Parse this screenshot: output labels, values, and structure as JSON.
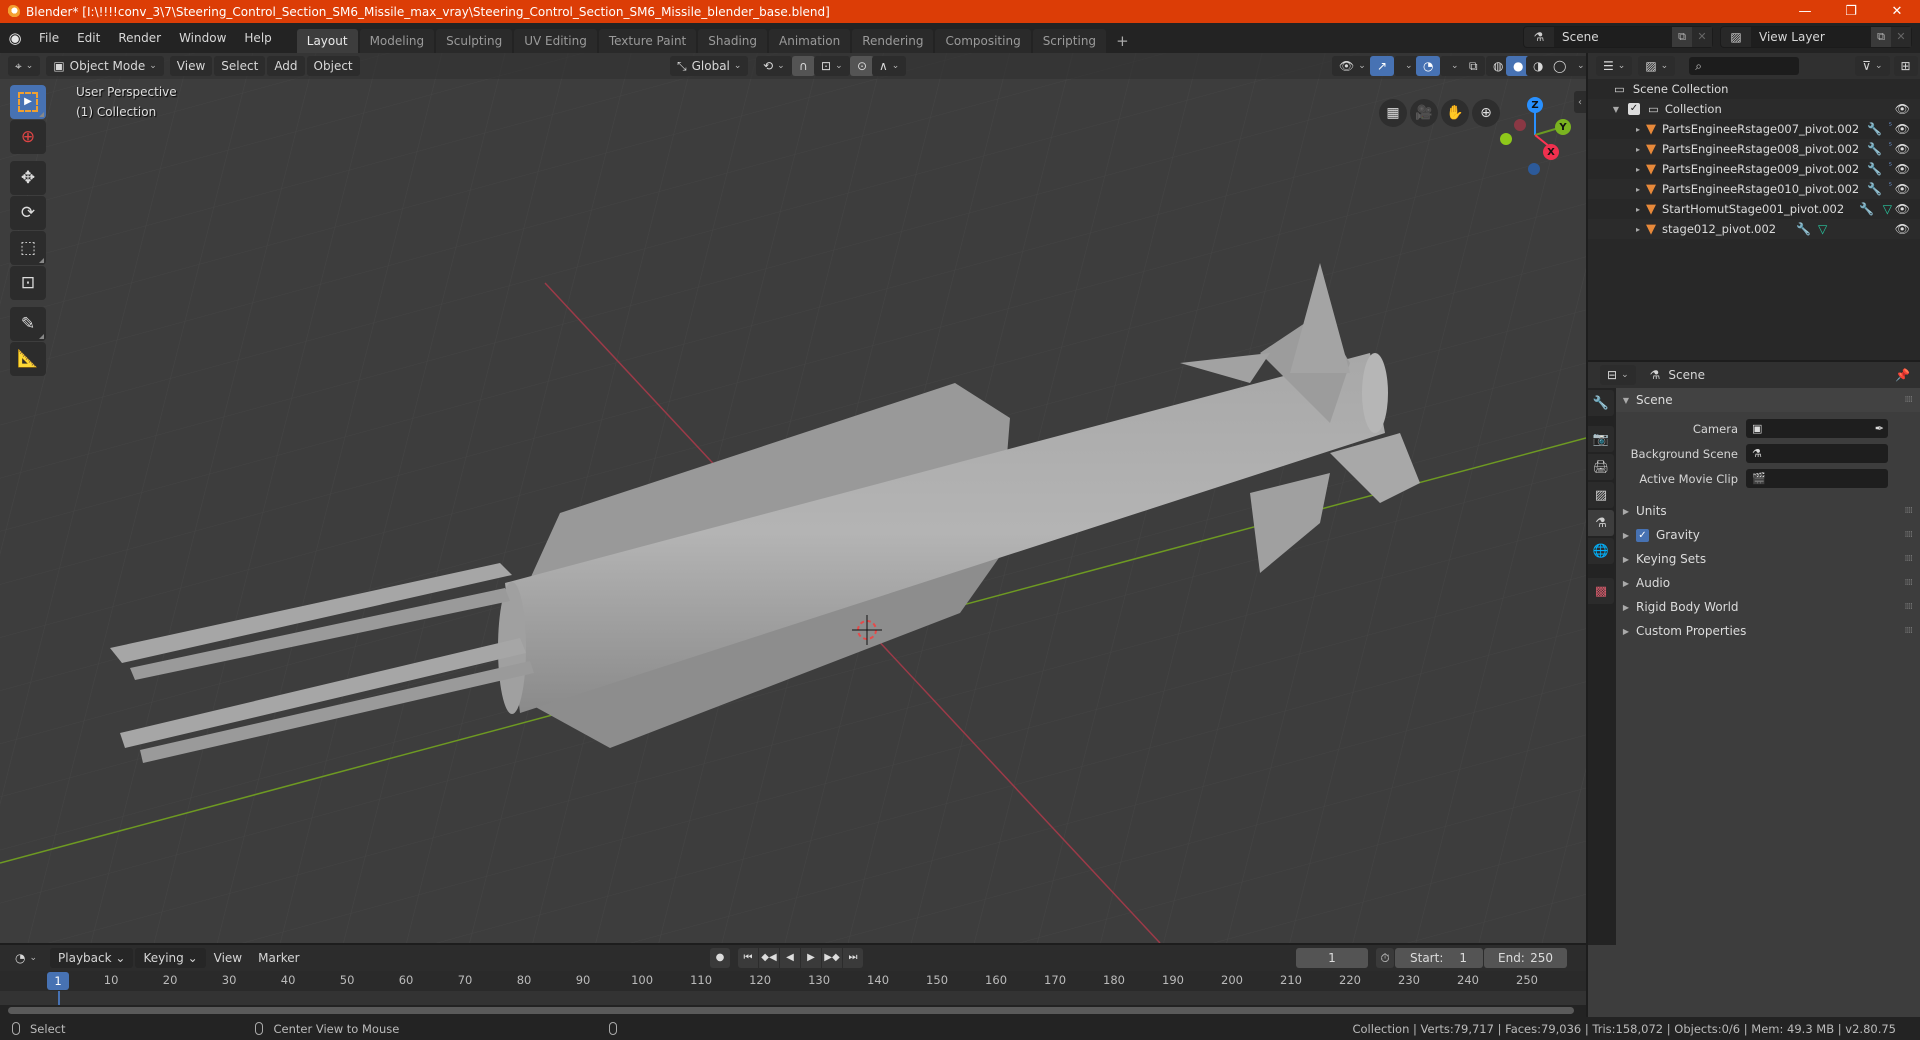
{
  "window": {
    "title": "Blender* [I:\\!!!!conv_3\\7\\Steering_Control_Section_SM6_Missile_max_vray\\Steering_Control_Section_SM6_Missile_blender_base.blend]",
    "controls": {
      "minimize": "—",
      "maximize": "❐",
      "close": "✕"
    }
  },
  "menubar": {
    "items": [
      "File",
      "Edit",
      "Render",
      "Window",
      "Help"
    ],
    "workspaces": [
      "Layout",
      "Modeling",
      "Sculpting",
      "UV Editing",
      "Texture Paint",
      "Shading",
      "Animation",
      "Rendering",
      "Compositing",
      "Scripting"
    ],
    "active_workspace": "Layout",
    "add_workspace": "+",
    "scene_name": "Scene",
    "view_layer_name": "View Layer"
  },
  "viewport": {
    "mode": "Object Mode",
    "menus": [
      "View",
      "Select",
      "Add",
      "Object"
    ],
    "transform_orientation": "Global",
    "overlay_text": {
      "view_name": "User Perspective",
      "collection": "(1) Collection"
    },
    "gizmo_axes": {
      "z": "Z",
      "y": "Y",
      "x": "X"
    },
    "axis_colors": {
      "x": "#ff3352",
      "y": "#8bdc00",
      "z": "#2890ff"
    },
    "tools": [
      "select-box",
      "cursor",
      "move",
      "rotate",
      "scale",
      "transform",
      "annotate",
      "measure"
    ],
    "active_tool": "select-box",
    "nav_icons": [
      "toggle-grid-icon",
      "camera-view-icon",
      "pan-hand-icon",
      "zoom-icon"
    ]
  },
  "outliner": {
    "root": "Scene Collection",
    "collection": "Collection",
    "objects": [
      {
        "name": "PartsEngineeRstage007_pivot.002",
        "modifiers": true,
        "mesh_data": false
      },
      {
        "name": "PartsEngineeRstage008_pivot.002",
        "modifiers": true,
        "mesh_data": false
      },
      {
        "name": "PartsEngineeRstage009_pivot.002",
        "modifiers": true,
        "mesh_data": false
      },
      {
        "name": "PartsEngineeRstage010_pivot.002",
        "modifiers": true,
        "mesh_data": false
      },
      {
        "name": "StartHomutStage001_pivot.002",
        "modifiers": true,
        "mesh_data": true
      },
      {
        "name": "stage012_pivot.002",
        "modifiers": true,
        "mesh_data": true
      }
    ]
  },
  "properties": {
    "context": "Scene",
    "panel_title": "Scene",
    "fields": [
      {
        "label": "Camera",
        "value": ""
      },
      {
        "label": "Background Scene",
        "value": ""
      },
      {
        "label": "Active Movie Clip",
        "value": ""
      }
    ],
    "subpanels": [
      {
        "label": "Units",
        "checkbox": false
      },
      {
        "label": "Gravity",
        "checkbox": true,
        "checked": true
      },
      {
        "label": "Keying Sets",
        "checkbox": false
      },
      {
        "label": "Audio",
        "checkbox": false
      },
      {
        "label": "Rigid Body World",
        "checkbox": false
      },
      {
        "label": "Custom Properties",
        "checkbox": false
      }
    ]
  },
  "timeline": {
    "menus": [
      "Playback",
      "Keying",
      "View",
      "Marker"
    ],
    "current_frame": "1",
    "start_label": "Start:",
    "start": "1",
    "end_label": "End:",
    "end": "250",
    "ruler_ticks": [
      "10",
      "20",
      "30",
      "40",
      "50",
      "60",
      "70",
      "80",
      "90",
      "100",
      "110",
      "120",
      "130",
      "140",
      "150",
      "160",
      "170",
      "180",
      "190",
      "200",
      "210",
      "220",
      "230",
      "240",
      "250"
    ],
    "playhead_label": "1"
  },
  "statusbar": {
    "left_action": "Select",
    "middle_action": "Center View to Mouse",
    "stats": "Collection | Verts:79,717 | Faces:79,036 | Tris:158,072 | Objects:0/6 | Mem: 49.3 MB | v2.80.75"
  }
}
